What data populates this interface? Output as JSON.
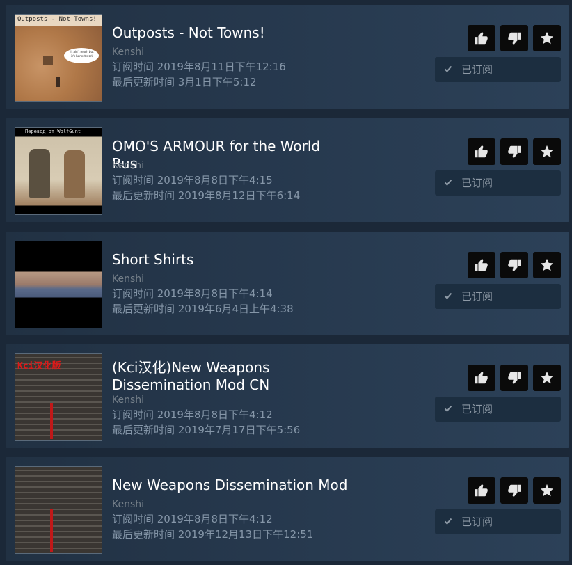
{
  "icons": {
    "thumbs_up": "thumbs-up-icon",
    "thumbs_down": "thumbs-down-icon",
    "favorite": "star-icon",
    "subscribed_check": "check-icon"
  },
  "colors": {
    "background": "#1b2838",
    "card": "#26384d",
    "title": "#ffffff",
    "meta": "#8596a8",
    "button": "#0a0a0a",
    "subscribed_bg": "#1c2e40"
  },
  "items": [
    {
      "title": "Outposts - Not Towns!",
      "game": "Kenshi",
      "subscribed": "订阅时间 2019年8月11日下午12:16",
      "updated": "最后更新时间 3月1日下午5:12",
      "subscribed_label": "已订阅",
      "thumb_text": "Outposts - Not Towns!",
      "thumb_bubble": "It ain't much but it's honest work"
    },
    {
      "title": "OMO'S ARMOUR for the World Rus",
      "game": "Kenshi",
      "subscribed": "订阅时间 2019年8月8日下午4:15",
      "updated": "最后更新时间 2019年8月12日下午6:14",
      "subscribed_label": "已订阅",
      "thumb_text": "Перевод от WolfGunt"
    },
    {
      "title": "Short Shirts",
      "game": "Kenshi",
      "subscribed": "订阅时间 2019年8月8日下午4:14",
      "updated": "最后更新时间 2019年6月4日上午4:38",
      "subscribed_label": "已订阅"
    },
    {
      "title": "(Kci汉化)New Weapons Dissemination Mod CN",
      "game": "Kenshi",
      "subscribed": "订阅时间 2019年8月8日下午4:12",
      "updated": "最后更新时间 2019年7月17日下午5:56",
      "subscribed_label": "已订阅",
      "thumb_text": "Kci汉化版"
    },
    {
      "title": "New Weapons Dissemination Mod",
      "game": "Kenshi",
      "subscribed": "订阅时间 2019年8月8日下午4:12",
      "updated": "最后更新时间 2019年12月13日下午12:51",
      "subscribed_label": "已订阅"
    }
  ]
}
